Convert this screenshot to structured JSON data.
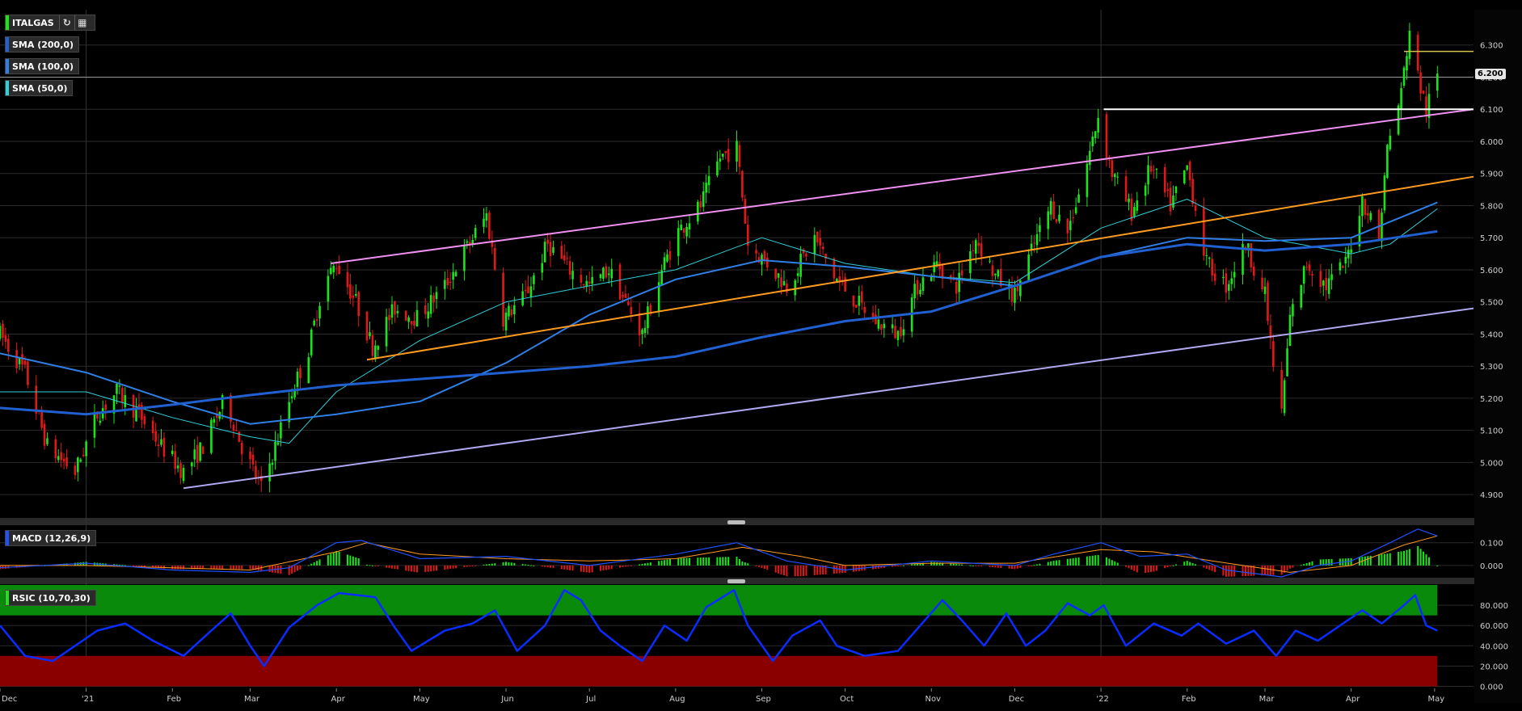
{
  "legends": {
    "main": "ITALGAS",
    "sma200": "SMA (200,0)",
    "sma100": "SMA (100,0)",
    "sma50": "SMA (50,0)",
    "macd": "MACD (12,26,9)",
    "rsic": "RSIC (10,70,30)"
  },
  "colors": {
    "background": "#000000",
    "candle_up": "#19e619",
    "candle_down": "#e01818",
    "sma200": "#2060d0",
    "sma100": "#2f7fe6",
    "sma50": "#30d0d8",
    "channel_upper": "#f090f0",
    "channel_lower": "#b0a8f0",
    "channel_mid": "#ff9a20",
    "resistance": "#ffffff",
    "level_6_28": "#d4c34a",
    "rsi_line": "#0a2cff",
    "rsi_overbought": "#0a8a0a",
    "rsi_oversold": "#8a0000",
    "macd_line": "#2050ff",
    "macd_signal": "#ff9a20"
  },
  "toolbar_icons": [
    "refresh-icon",
    "calendar-icon"
  ],
  "chart_data": {
    "type": "candlestick",
    "x_axis": {
      "start": "2020-12-01",
      "end": "2022-05-15",
      "tick_labels": [
        "Dec",
        "'21",
        "Feb",
        "Mar",
        "Apr",
        "May",
        "Jun",
        "Jul",
        "Aug",
        "Sep",
        "Oct",
        "Nov",
        "Dec",
        "'22",
        "Feb",
        "Mar",
        "Apr",
        "May"
      ],
      "tick_dates": [
        "2020-12-01",
        "2021-01-01",
        "2021-02-01",
        "2021-03-01",
        "2021-04-01",
        "2021-05-01",
        "2021-06-01",
        "2021-07-01",
        "2021-08-01",
        "2021-09-01",
        "2021-10-01",
        "2021-11-01",
        "2021-12-01",
        "2022-01-01",
        "2022-02-01",
        "2022-03-01",
        "2022-04-01",
        "2022-05-01"
      ]
    },
    "price_axis": {
      "ylim": [
        4.83,
        6.41
      ],
      "ticks": [
        "4.900",
        "5.000",
        "5.100",
        "5.200",
        "5.300",
        "5.400",
        "5.500",
        "5.600",
        "5.700",
        "5.800",
        "5.900",
        "6.000",
        "6.100",
        "6.200",
        "6.300"
      ],
      "last_price": "6.200"
    },
    "price_path": [
      [
        "2020-12-01",
        5.4
      ],
      [
        "2020-12-10",
        5.28
      ],
      [
        "2020-12-18",
        5.05
      ],
      [
        "2020-12-28",
        4.97
      ],
      [
        "2021-01-05",
        5.15
      ],
      [
        "2021-01-12",
        5.22
      ],
      [
        "2021-01-20",
        5.15
      ],
      [
        "2021-01-28",
        5.05
      ],
      [
        "2021-02-05",
        4.97
      ],
      [
        "2021-02-12",
        5.05
      ],
      [
        "2021-02-20",
        5.2
      ],
      [
        "2021-02-26",
        5.05
      ],
      [
        "2021-03-05",
        4.92
      ],
      [
        "2021-03-10",
        5.05
      ],
      [
        "2021-03-16",
        5.22
      ],
      [
        "2021-03-22",
        5.35
      ],
      [
        "2021-03-27",
        5.55
      ],
      [
        "2021-04-01",
        5.62
      ],
      [
        "2021-04-08",
        5.5
      ],
      [
        "2021-04-14",
        5.36
      ],
      [
        "2021-04-22",
        5.48
      ],
      [
        "2021-04-30",
        5.45
      ],
      [
        "2021-05-10",
        5.55
      ],
      [
        "2021-05-20",
        5.7
      ],
      [
        "2021-05-25",
        5.77
      ],
      [
        "2021-05-31",
        5.45
      ],
      [
        "2021-06-08",
        5.52
      ],
      [
        "2021-06-16",
        5.68
      ],
      [
        "2021-06-24",
        5.6
      ],
      [
        "2021-07-01",
        5.55
      ],
      [
        "2021-07-08",
        5.6
      ],
      [
        "2021-07-14",
        5.5
      ],
      [
        "2021-07-20",
        5.4
      ],
      [
        "2021-07-27",
        5.6
      ],
      [
        "2021-08-02",
        5.72
      ],
      [
        "2021-08-10",
        5.8
      ],
      [
        "2021-08-17",
        5.95
      ],
      [
        "2021-08-23",
        5.98
      ],
      [
        "2021-08-27",
        5.68
      ],
      [
        "2021-09-03",
        5.62
      ],
      [
        "2021-09-10",
        5.55
      ],
      [
        "2021-09-20",
        5.7
      ],
      [
        "2021-09-27",
        5.58
      ],
      [
        "2021-10-05",
        5.5
      ],
      [
        "2021-10-12",
        5.44
      ],
      [
        "2021-10-20",
        5.4
      ],
      [
        "2021-10-27",
        5.55
      ],
      [
        "2021-11-03",
        5.62
      ],
      [
        "2021-11-10",
        5.55
      ],
      [
        "2021-11-17",
        5.7
      ],
      [
        "2021-11-24",
        5.58
      ],
      [
        "2021-12-01",
        5.52
      ],
      [
        "2021-12-08",
        5.68
      ],
      [
        "2021-12-14",
        5.8
      ],
      [
        "2021-12-20",
        5.72
      ],
      [
        "2021-12-27",
        5.93
      ],
      [
        "2021-12-31",
        6.08
      ],
      [
        "2022-01-05",
        5.9
      ],
      [
        "2022-01-12",
        5.78
      ],
      [
        "2022-01-19",
        5.92
      ],
      [
        "2022-01-26",
        5.8
      ],
      [
        "2022-02-01",
        5.92
      ],
      [
        "2022-02-08",
        5.62
      ],
      [
        "2022-02-15",
        5.55
      ],
      [
        "2022-02-22",
        5.68
      ],
      [
        "2022-03-01",
        5.52
      ],
      [
        "2022-03-04",
        5.3
      ],
      [
        "2022-03-07",
        5.15
      ],
      [
        "2022-03-10",
        5.45
      ],
      [
        "2022-03-16",
        5.62
      ],
      [
        "2022-03-23",
        5.55
      ],
      [
        "2022-03-30",
        5.62
      ],
      [
        "2022-04-05",
        5.82
      ],
      [
        "2022-04-11",
        5.7
      ],
      [
        "2022-04-14",
        5.98
      ],
      [
        "2022-04-19",
        6.15
      ],
      [
        "2022-04-22",
        6.35
      ],
      [
        "2022-04-25",
        6.2
      ],
      [
        "2022-04-28",
        6.1
      ],
      [
        "2022-05-02",
        6.2
      ]
    ],
    "sma50_path": [
      [
        "2020-12-01",
        5.22
      ],
      [
        "2021-01-01",
        5.22
      ],
      [
        "2021-02-01",
        5.14
      ],
      [
        "2021-03-01",
        5.08
      ],
      [
        "2021-03-15",
        5.06
      ],
      [
        "2021-04-01",
        5.22
      ],
      [
        "2021-05-01",
        5.38
      ],
      [
        "2021-06-01",
        5.5
      ],
      [
        "2021-07-01",
        5.55
      ],
      [
        "2021-08-01",
        5.6
      ],
      [
        "2021-09-01",
        5.7
      ],
      [
        "2021-10-01",
        5.62
      ],
      [
        "2021-11-01",
        5.58
      ],
      [
        "2021-12-01",
        5.56
      ],
      [
        "2022-01-01",
        5.73
      ],
      [
        "2022-02-01",
        5.82
      ],
      [
        "2022-03-01",
        5.7
      ],
      [
        "2022-04-01",
        5.65
      ],
      [
        "2022-04-15",
        5.68
      ],
      [
        "2022-05-02",
        5.79
      ]
    ],
    "sma100_path": [
      [
        "2020-12-01",
        5.34
      ],
      [
        "2021-01-01",
        5.28
      ],
      [
        "2021-02-01",
        5.19
      ],
      [
        "2021-03-01",
        5.12
      ],
      [
        "2021-04-01",
        5.15
      ],
      [
        "2021-05-01",
        5.19
      ],
      [
        "2021-06-01",
        5.31
      ],
      [
        "2021-07-01",
        5.46
      ],
      [
        "2021-08-01",
        5.57
      ],
      [
        "2021-09-01",
        5.63
      ],
      [
        "2021-10-01",
        5.61
      ],
      [
        "2021-11-01",
        5.58
      ],
      [
        "2021-12-01",
        5.55
      ],
      [
        "2022-01-01",
        5.64
      ],
      [
        "2022-02-01",
        5.7
      ],
      [
        "2022-03-01",
        5.69
      ],
      [
        "2022-04-01",
        5.7
      ],
      [
        "2022-05-02",
        5.81
      ]
    ],
    "sma200_path": [
      [
        "2020-12-01",
        5.17
      ],
      [
        "2021-01-01",
        5.15
      ],
      [
        "2021-02-01",
        5.18
      ],
      [
        "2021-03-01",
        5.21
      ],
      [
        "2021-04-01",
        5.24
      ],
      [
        "2021-05-01",
        5.26
      ],
      [
        "2021-06-01",
        5.28
      ],
      [
        "2021-07-01",
        5.3
      ],
      [
        "2021-08-01",
        5.33
      ],
      [
        "2021-09-01",
        5.39
      ],
      [
        "2021-10-01",
        5.44
      ],
      [
        "2021-11-01",
        5.47
      ],
      [
        "2021-12-01",
        5.55
      ],
      [
        "2022-01-01",
        5.64
      ],
      [
        "2022-02-01",
        5.68
      ],
      [
        "2022-03-01",
        5.66
      ],
      [
        "2022-04-01",
        5.68
      ],
      [
        "2022-05-02",
        5.72
      ]
    ],
    "trendlines": [
      {
        "name": "upper-channel",
        "from": [
          "2021-03-30",
          5.62
        ],
        "to": [
          "2022-05-15",
          6.1
        ]
      },
      {
        "name": "mid-channel",
        "from": [
          "2021-04-12",
          5.32
        ],
        "to": [
          "2022-05-15",
          5.89
        ]
      },
      {
        "name": "lower-channel",
        "from": [
          "2021-02-05",
          4.92
        ],
        "to": [
          "2022-05-15",
          5.48
        ]
      },
      {
        "name": "resistance-6.10",
        "from": [
          "2022-01-02",
          6.1
        ],
        "to": [
          "2022-05-15",
          6.1
        ]
      },
      {
        "name": "level-6.28",
        "from": [
          "2022-04-20",
          6.28
        ],
        "to": [
          "2022-05-15",
          6.28
        ]
      }
    ],
    "macd": {
      "ylim": [
        -0.05,
        0.17
      ],
      "ticks": [
        "0.000",
        "0.100"
      ],
      "macd_path": [
        [
          "2020-12-01",
          -0.01
        ],
        [
          "2021-01-01",
          0.01
        ],
        [
          "2021-02-01",
          -0.02
        ],
        [
          "2021-03-01",
          -0.03
        ],
        [
          "2021-03-15",
          -0.01
        ],
        [
          "2021-04-01",
          0.1
        ],
        [
          "2021-04-10",
          0.11
        ],
        [
          "2021-05-01",
          0.03
        ],
        [
          "2021-06-01",
          0.04
        ],
        [
          "2021-07-01",
          0.0
        ],
        [
          "2021-08-01",
          0.05
        ],
        [
          "2021-08-23",
          0.1
        ],
        [
          "2021-09-10",
          0.02
        ],
        [
          "2021-10-01",
          -0.02
        ],
        [
          "2021-11-01",
          0.02
        ],
        [
          "2021-12-01",
          0.0
        ],
        [
          "2021-12-15",
          0.05
        ],
        [
          "2022-01-01",
          0.1
        ],
        [
          "2022-01-15",
          0.04
        ],
        [
          "2022-02-01",
          0.05
        ],
        [
          "2022-02-15",
          -0.02
        ],
        [
          "2022-03-07",
          -0.05
        ],
        [
          "2022-03-20",
          0.0
        ],
        [
          "2022-04-01",
          0.02
        ],
        [
          "2022-04-15",
          0.1
        ],
        [
          "2022-04-25",
          0.16
        ],
        [
          "2022-05-02",
          0.13
        ]
      ],
      "signal_path": [
        [
          "2020-12-01",
          0.0
        ],
        [
          "2021-01-01",
          0.0
        ],
        [
          "2021-02-01",
          -0.01
        ],
        [
          "2021-03-01",
          -0.02
        ],
        [
          "2021-04-01",
          0.06
        ],
        [
          "2021-04-12",
          0.1
        ],
        [
          "2021-05-01",
          0.05
        ],
        [
          "2021-06-01",
          0.03
        ],
        [
          "2021-07-01",
          0.02
        ],
        [
          "2021-08-01",
          0.03
        ],
        [
          "2021-08-25",
          0.08
        ],
        [
          "2021-09-15",
          0.04
        ],
        [
          "2021-10-01",
          0.0
        ],
        [
          "2021-11-01",
          0.01
        ],
        [
          "2021-12-01",
          0.01
        ],
        [
          "2022-01-01",
          0.07
        ],
        [
          "2022-01-20",
          0.06
        ],
        [
          "2022-02-10",
          0.02
        ],
        [
          "2022-03-10",
          -0.03
        ],
        [
          "2022-04-01",
          0.0
        ],
        [
          "2022-04-20",
          0.09
        ],
        [
          "2022-05-02",
          0.13
        ]
      ]
    },
    "rsi": {
      "ylim": [
        -2,
        100
      ],
      "ticks": [
        "0.000",
        "20.000",
        "40.000",
        "60.000",
        "80.000"
      ],
      "overbought": 70,
      "oversold": 30,
      "path": [
        [
          "2020-12-01",
          60
        ],
        [
          "2020-12-10",
          30
        ],
        [
          "2020-12-20",
          25
        ],
        [
          "2021-01-05",
          55
        ],
        [
          "2021-01-15",
          62
        ],
        [
          "2021-01-25",
          45
        ],
        [
          "2021-02-05",
          30
        ],
        [
          "2021-02-15",
          55
        ],
        [
          "2021-02-22",
          72
        ],
        [
          "2021-03-01",
          40
        ],
        [
          "2021-03-06",
          20
        ],
        [
          "2021-03-15",
          58
        ],
        [
          "2021-03-25",
          80
        ],
        [
          "2021-04-02",
          92
        ],
        [
          "2021-04-15",
          88
        ],
        [
          "2021-04-22",
          58
        ],
        [
          "2021-04-28",
          35
        ],
        [
          "2021-05-10",
          55
        ],
        [
          "2021-05-20",
          62
        ],
        [
          "2021-05-28",
          75
        ],
        [
          "2021-06-05",
          35
        ],
        [
          "2021-06-15",
          60
        ],
        [
          "2021-06-22",
          95
        ],
        [
          "2021-06-28",
          85
        ],
        [
          "2021-07-05",
          55
        ],
        [
          "2021-07-12",
          40
        ],
        [
          "2021-07-20",
          25
        ],
        [
          "2021-07-28",
          60
        ],
        [
          "2021-08-05",
          45
        ],
        [
          "2021-08-12",
          78
        ],
        [
          "2021-08-22",
          95
        ],
        [
          "2021-08-27",
          60
        ],
        [
          "2021-09-05",
          25
        ],
        [
          "2021-09-12",
          50
        ],
        [
          "2021-09-22",
          65
        ],
        [
          "2021-09-28",
          40
        ],
        [
          "2021-10-08",
          30
        ],
        [
          "2021-10-20",
          35
        ],
        [
          "2021-10-28",
          60
        ],
        [
          "2021-11-05",
          85
        ],
        [
          "2021-11-12",
          65
        ],
        [
          "2021-11-20",
          40
        ],
        [
          "2021-11-28",
          72
        ],
        [
          "2021-12-05",
          40
        ],
        [
          "2021-12-12",
          55
        ],
        [
          "2021-12-20",
          82
        ],
        [
          "2021-12-28",
          70
        ],
        [
          "2022-01-02",
          80
        ],
        [
          "2022-01-10",
          40
        ],
        [
          "2022-01-20",
          62
        ],
        [
          "2022-01-30",
          50
        ],
        [
          "2022-02-05",
          62
        ],
        [
          "2022-02-15",
          42
        ],
        [
          "2022-02-25",
          55
        ],
        [
          "2022-03-05",
          30
        ],
        [
          "2022-03-12",
          55
        ],
        [
          "2022-03-20",
          45
        ],
        [
          "2022-03-28",
          60
        ],
        [
          "2022-04-05",
          75
        ],
        [
          "2022-04-12",
          62
        ],
        [
          "2022-04-20",
          80
        ],
        [
          "2022-04-24",
          90
        ],
        [
          "2022-04-28",
          60
        ],
        [
          "2022-05-02",
          55
        ]
      ]
    }
  }
}
